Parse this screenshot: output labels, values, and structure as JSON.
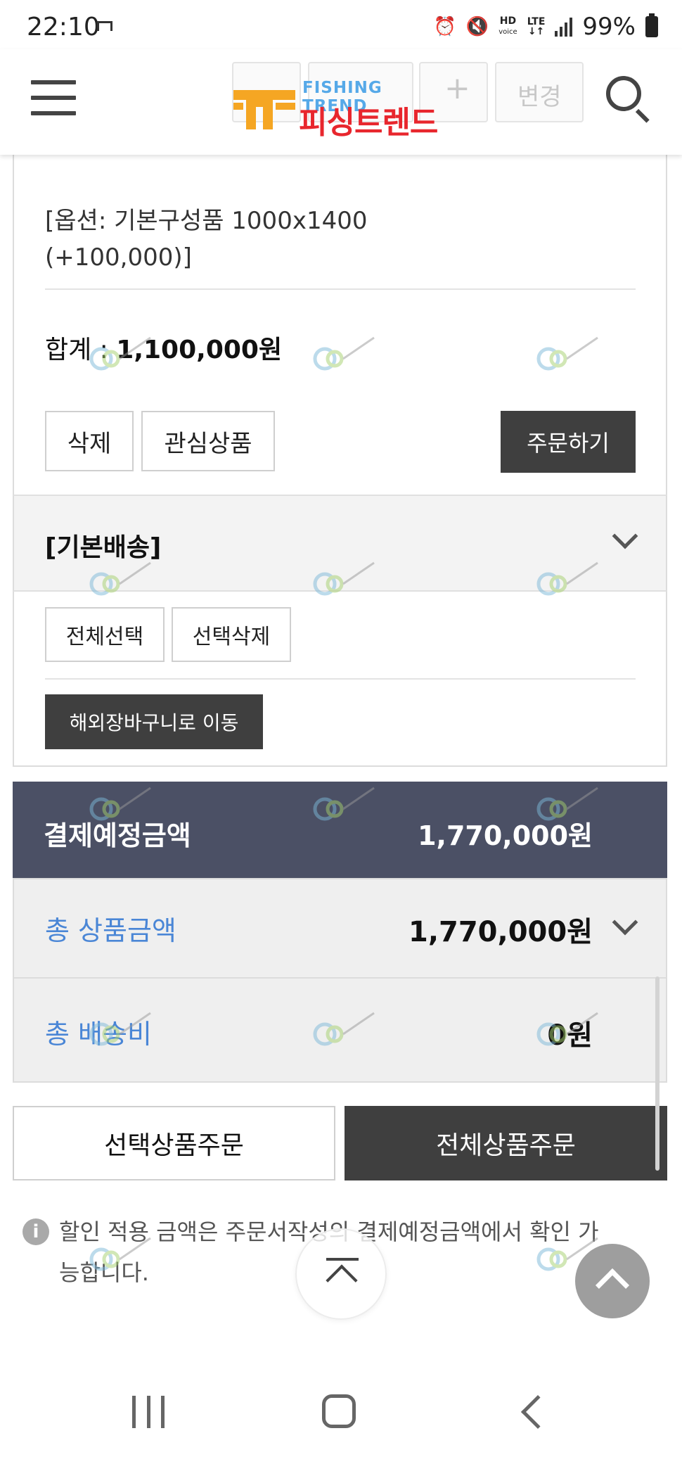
{
  "status_bar": {
    "time": "22:10",
    "hd_label": "HD",
    "voice_label": "voice",
    "lte_label": "LTE",
    "battery": "99%"
  },
  "header": {
    "logo_sub": "FISHING TREND",
    "logo_main": "피싱트렌드",
    "ghost_change_label": "변경",
    "ghost_plus": "+"
  },
  "cart_item": {
    "option_text": "[옵션: 기본구성품 1000x1400 (+100,000)]",
    "total_label": "합계 : ",
    "total_value": "1,100,000원",
    "delete_label": "삭제",
    "wishlist_label": "관심상품",
    "order_label": "주문하기"
  },
  "delivery_section": {
    "title": "[기본배송]",
    "select_all_label": "전체선택",
    "delete_selected_label": "선택삭제",
    "move_overseas_label": "해외장바구니로 이동"
  },
  "payment": {
    "estimated_label": "결제예정금액",
    "estimated_value": "1,770,000원",
    "product_total_label": "총 상품금액",
    "product_total_value": "1,770,000원",
    "shipping_label": "총 배송비",
    "shipping_value": "0원"
  },
  "actions": {
    "order_selected_label": "선택상품주문",
    "order_all_label": "전체상품주문"
  },
  "notice": {
    "icon": "i",
    "text": "할인 적용 금액은 주문서작성의 결제예정금액에서 확인 가능합니다."
  },
  "colors": {
    "pay_header_bg": "#4b5065",
    "dark_button": "#3f3f3f",
    "label_blue": "#4a86d6",
    "logo_red": "#e8262d",
    "logo_orange": "#f5a623"
  }
}
